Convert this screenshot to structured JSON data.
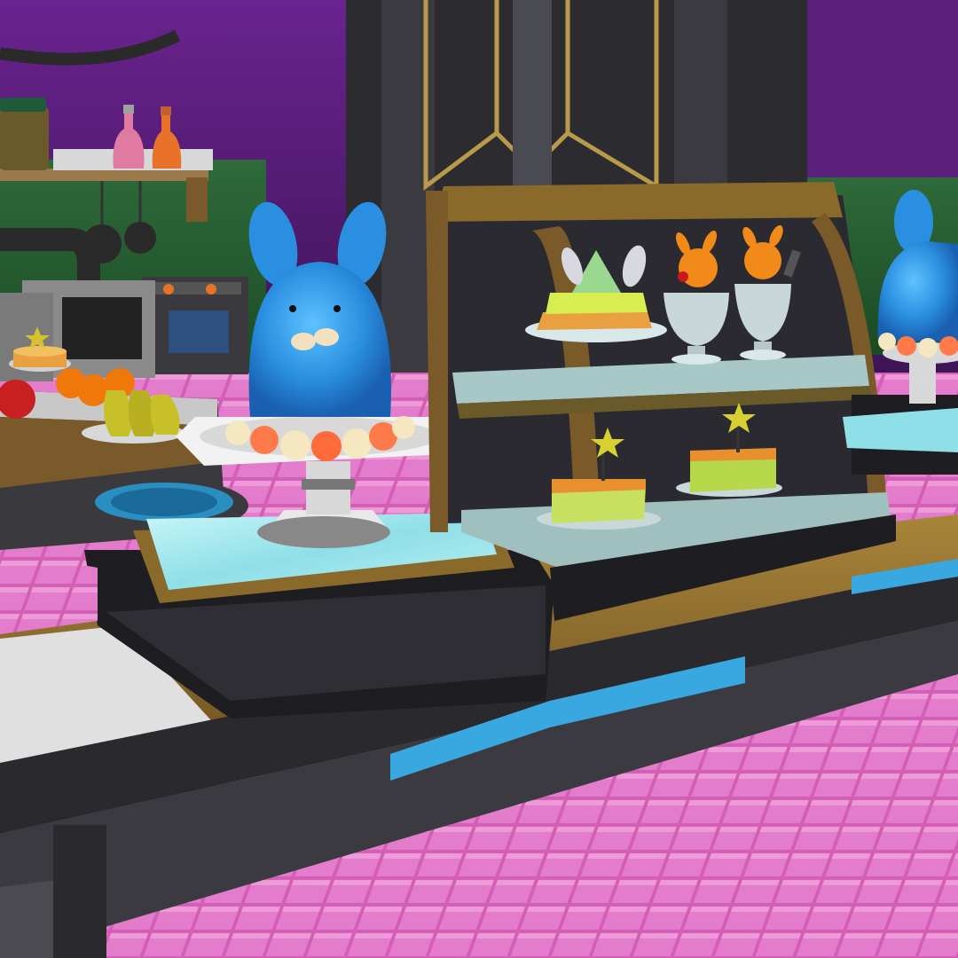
{
  "scene": {
    "kind": "3d-game-screenshot",
    "subject": "dessert-shop-counter",
    "palette": {
      "wall_purple": "#5a1f7a",
      "floor_pink": "#d85fb8",
      "counter_gold": "#8a6a2a",
      "counter_dark": "#2b2b30",
      "water_cyan": "#9fe6ec",
      "blob_blue": "#2a8fe0",
      "case_frame": "#7a5a28",
      "lime": "#b6d84a",
      "orange": "#f28a1a"
    },
    "props": [
      "blue-bunny-dessert",
      "display-case",
      "cake-stand",
      "fruit-bowl",
      "stove",
      "wall-shelf",
      "potion-bottle",
      "bunny-parfait",
      "star-cake",
      "green-pudding"
    ]
  }
}
